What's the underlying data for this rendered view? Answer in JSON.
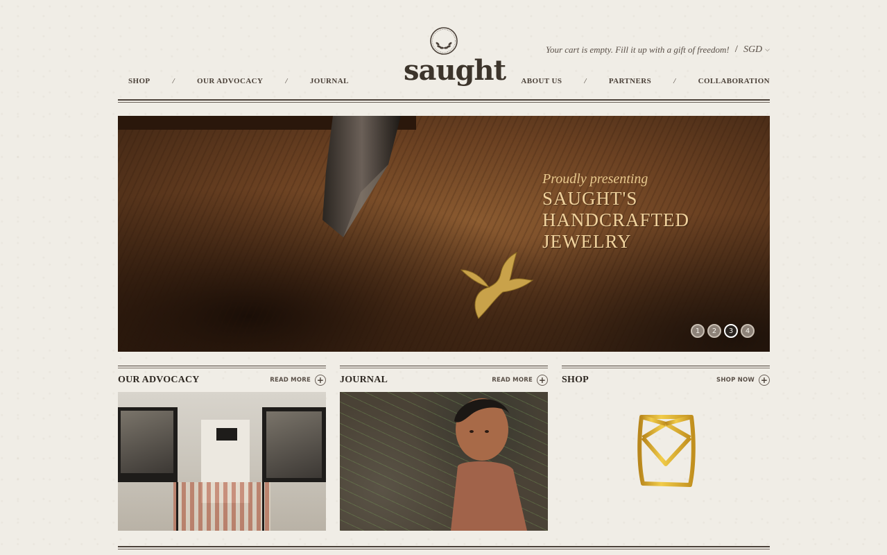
{
  "header": {
    "cart_text": "Your cart is empty. Fill it up with a gift of freedom!",
    "divider": "/",
    "currency": "SGD",
    "logo_text": "saught"
  },
  "nav": {
    "left": [
      {
        "label": "SHOP"
      },
      {
        "label": "OUR ADVOCACY"
      },
      {
        "label": "JOURNAL"
      }
    ],
    "right": [
      {
        "label": "ABOUT US"
      },
      {
        "label": "PARTNERS"
      },
      {
        "label": "COLLABORATION"
      }
    ],
    "separator": "/"
  },
  "hero": {
    "pre_title": "Proudly presenting",
    "title_lines": [
      "SAUGHT'S",
      "HANDCRAFTED",
      "JEWELRY"
    ],
    "slides": [
      "1",
      "2",
      "3",
      "4"
    ],
    "active_slide": 3
  },
  "sections": [
    {
      "title": "OUR ADVOCACY",
      "link": "READ MORE"
    },
    {
      "title": "JOURNAL",
      "link": "READ MORE"
    },
    {
      "title": "SHOP",
      "link": "SHOP NOW"
    }
  ],
  "colors": {
    "background": "#f0ede6",
    "text": "#3b342c",
    "hero_gold": "#f1d39e"
  }
}
